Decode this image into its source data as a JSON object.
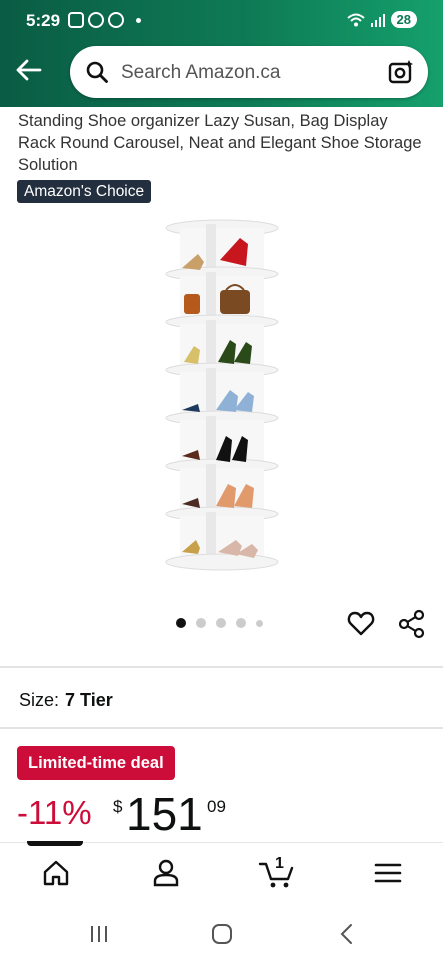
{
  "status_bar": {
    "time": "5:29",
    "battery": "28"
  },
  "header": {
    "search_placeholder": "Search Amazon.ca"
  },
  "product": {
    "title": "Standing Shoe organizer Lazy Susan, Bag Display Rack Round Carousel, Neat and Elegant Shoe Storage Solution",
    "badge": "Amazon's Choice",
    "image_count": 5,
    "active_image_index": 0
  },
  "size": {
    "label": "Size:",
    "value": "7 Tier"
  },
  "deal": {
    "badge": "Limited-time deal",
    "discount": "-11%",
    "currency": "$",
    "price_whole": "151",
    "price_fraction": "09"
  },
  "cart": {
    "count": "1"
  },
  "colors": {
    "header_green": "#0e7a55",
    "deal_red": "#cc0c39",
    "badge_dark": "#232f3e"
  },
  "icons": [
    "back-arrow-icon",
    "search-icon",
    "camera-search-icon",
    "heart-icon",
    "share-icon",
    "home-icon",
    "account-icon",
    "cart-icon",
    "menu-icon"
  ]
}
